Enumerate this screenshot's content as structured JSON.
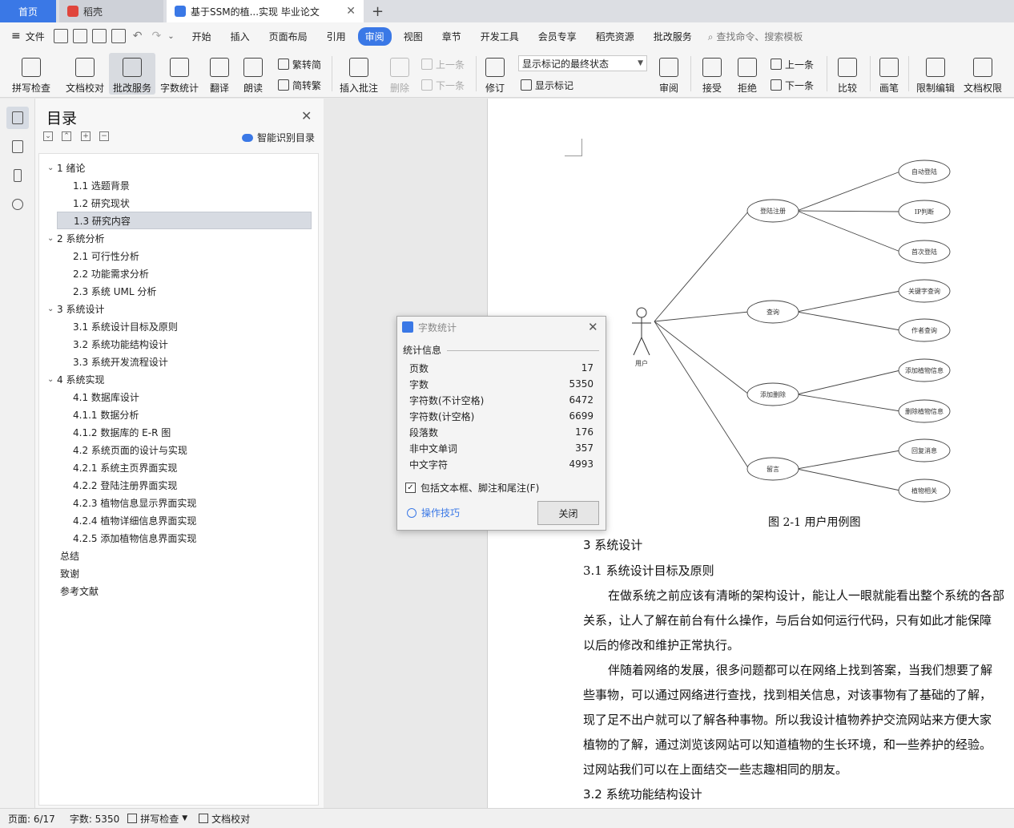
{
  "tabs": {
    "home": "首页",
    "docer": "稻壳",
    "document": "基于SSM的植...实现 毕业论文"
  },
  "menu": {
    "file": "文件",
    "items": [
      "开始",
      "插入",
      "页面布局",
      "引用",
      "审阅",
      "视图",
      "章节",
      "开发工具",
      "会员专享",
      "稻壳资源",
      "批改服务"
    ],
    "active_index": 4,
    "search_placeholder": "查找命令、搜索模板"
  },
  "ribbon": {
    "spell_check": "拼写检查",
    "doc_check": "文档校对",
    "review_service": "批改服务",
    "word_count": "字数统计",
    "translate": "翻译",
    "read_aloud": "朗读",
    "trad_to_simp": "繁转简",
    "simp_to_trad": "简转繁",
    "insert_comment": "插入批注",
    "delete": "删除",
    "prev": "上一条",
    "next": "下一条",
    "track_changes": "修订",
    "markup_state": "显示标记的最终状态",
    "show_markup": "显示标记",
    "review": "审阅",
    "accept": "接受",
    "reject": "拒绝",
    "prev_change": "上一条",
    "next_change": "下一条",
    "compare": "比较",
    "pen": "画笔",
    "restrict_edit": "限制编辑",
    "doc_permission": "文档权限"
  },
  "toc": {
    "title": "目录",
    "smart_label": "智能识别目录",
    "items": [
      {
        "level": 1,
        "text": "1   绪论",
        "expanded": true
      },
      {
        "level": 2,
        "text": "1.1  选题背景"
      },
      {
        "level": 2,
        "text": "1.2 研究现状"
      },
      {
        "level": 2,
        "text": "1.3  研究内容",
        "selected": true
      },
      {
        "level": 1,
        "text": "2 系统分析",
        "expanded": true
      },
      {
        "level": 2,
        "text": "2.1  可行性分析"
      },
      {
        "level": 2,
        "text": "2.2  功能需求分析"
      },
      {
        "level": 2,
        "text": "2.3  系统 UML 分析"
      },
      {
        "level": 1,
        "text": "3  系统设计",
        "expanded": true
      },
      {
        "level": 2,
        "text": "3.1 系统设计目标及原则"
      },
      {
        "level": 2,
        "text": "3.2  系统功能结构设计"
      },
      {
        "level": 2,
        "text": "3.3  系统开发流程设计"
      },
      {
        "level": 1,
        "text": "4  系统实现",
        "expanded": true
      },
      {
        "level": 2,
        "text": "4.1 数据库设计"
      },
      {
        "level": 2,
        "text": "4.1.1 数据分析"
      },
      {
        "level": 2,
        "text": "4.1.2 数据库的 E-R 图"
      },
      {
        "level": 2,
        "text": "4.2  系统页面的设计与实现"
      },
      {
        "level": 2,
        "text": "4.2.1 系统主页界面实现"
      },
      {
        "level": 2,
        "text": "4.2.2 登陆注册界面实现"
      },
      {
        "level": 2,
        "text": "4.2.3 植物信息显示界面实现"
      },
      {
        "level": 2,
        "text": "4.2.4 植物详细信息界面实现"
      },
      {
        "level": 2,
        "text": "4.2.5 添加植物信息界面实现"
      },
      {
        "level": 0,
        "text": "总结"
      },
      {
        "level": 0,
        "text": "致谢"
      },
      {
        "level": 0,
        "text": "参考文献"
      }
    ]
  },
  "dialog": {
    "title": "字数统计",
    "section": "统计信息",
    "stats": [
      {
        "label": "页数",
        "value": "17"
      },
      {
        "label": "字数",
        "value": "5350"
      },
      {
        "label": "字符数(不计空格)",
        "value": "6472"
      },
      {
        "label": "字符数(计空格)",
        "value": "6699"
      },
      {
        "label": "段落数",
        "value": "176"
      },
      {
        "label": "非中文单词",
        "value": "357"
      },
      {
        "label": "中文字符",
        "value": "4993"
      }
    ],
    "checkbox_label": "包括文本框、脚注和尾注(F)",
    "checkbox_checked": true,
    "tips": "操作技巧",
    "close_button": "关闭"
  },
  "diagram": {
    "actor": "用户",
    "nodes": [
      {
        "label": "登陆注册",
        "children": [
          "自动登陆",
          "IP判断",
          "首次登陆"
        ]
      },
      {
        "label": "查询",
        "children": [
          "关键字查询",
          "作者查询"
        ]
      },
      {
        "label": "添加删除",
        "children": [
          "添加植物信息",
          "删除植物信息"
        ]
      },
      {
        "label": "留言",
        "children": [
          "回复消息",
          "植物相关"
        ]
      }
    ]
  },
  "document": {
    "figure_caption": "图 2-1   用户用例图",
    "heading_3": "3  系统设计",
    "heading_31": "3.1 系统设计目标及原则",
    "para1_line1": "在做系统之前应该有清晰的架构设计，能让人一眼就能看出整个系统的各部",
    "para1_line2": "关系，让人了解在前台有什么操作，与后台如何运行代码，只有如此才能保障",
    "para1_line3": "以后的修改和维护正常执行。",
    "para2_line1": "伴随着网络的发展，很多问题都可以在网络上找到答案，当我们想要了解",
    "para2_line2": "些事物，可以通过网络进行查找，找到相关信息，对该事物有了基础的了解，",
    "para2_line3": "现了足不出户就可以了解各种事物。所以我设计植物养护交流网站来方便大家",
    "para2_line4": "植物的了解，通过浏览该网站可以知道植物的生长环境，和一些养护的经验。",
    "para2_line5": "过网站我们可以在上面结交一些志趣相同的朋友。",
    "heading_32": "3.2  系统功能结构设计"
  },
  "status": {
    "page": "页面: 6/17",
    "words": "字数: 5350",
    "spell_check": "拼写检查",
    "doc_check": "文档校对"
  },
  "colors": {
    "accent": "#3a78e6"
  }
}
